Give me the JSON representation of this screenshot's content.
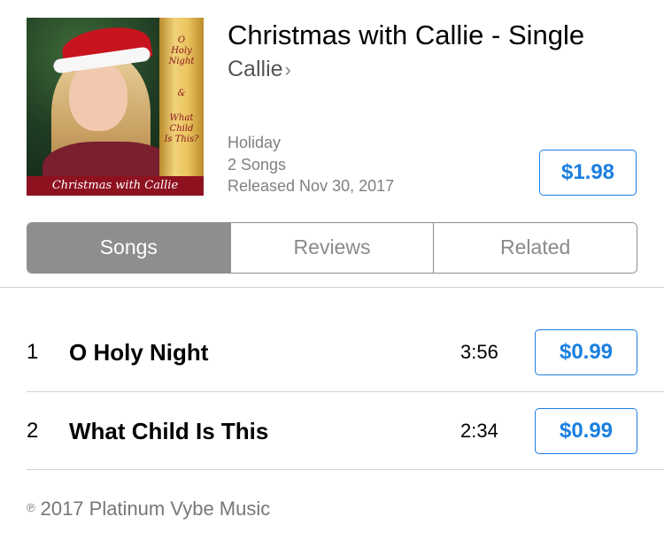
{
  "album": {
    "title": "Christmas with Callie - Single",
    "artist": "Callie",
    "artist_chevron": "›",
    "genre": "Holiday",
    "song_count": "2 Songs",
    "released": "Released Nov 30, 2017",
    "price": "$1.98",
    "artwork": {
      "banner_line1": "O",
      "banner_line2": "Holy",
      "banner_line3": "Night",
      "banner_amp": "&",
      "banner_line4": "What",
      "banner_line5": "Child",
      "banner_line6": "Is This?",
      "caption": "Christmas with Callie"
    }
  },
  "tabs": [
    {
      "label": "Songs",
      "active": true
    },
    {
      "label": "Reviews",
      "active": false
    },
    {
      "label": "Related",
      "active": false
    }
  ],
  "tracks": [
    {
      "number": "1",
      "name": "O Holy Night",
      "duration": "3:56",
      "price": "$0.99"
    },
    {
      "number": "2",
      "name": "What Child Is This",
      "duration": "2:34",
      "price": "$0.99"
    }
  ],
  "copyright": {
    "symbol": "℗",
    "text": "2017 Platinum Vybe Music"
  },
  "colors": {
    "accent": "#1a7fe0",
    "segment_active": "#8e8e8e",
    "secondary_text": "#808080"
  }
}
